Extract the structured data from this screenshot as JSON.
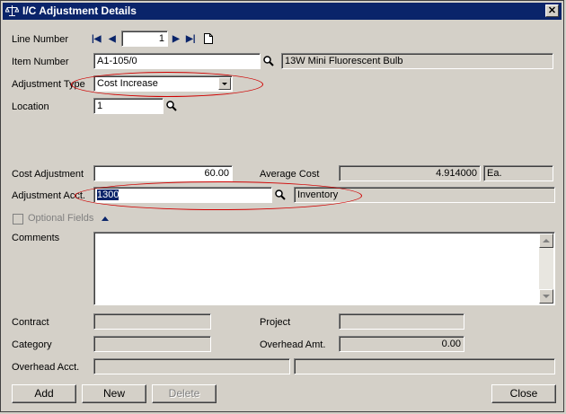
{
  "window": {
    "title": "I/C Adjustment Details"
  },
  "labels": {
    "line_number": "Line Number",
    "item_number": "Item Number",
    "adjustment_type": "Adjustment Type",
    "location": "Location",
    "cost_adjustment": "Cost Adjustment",
    "average_cost": "Average Cost",
    "adjustment_acct": "Adjustment Acct.",
    "optional_fields": "Optional Fields",
    "comments": "Comments",
    "contract": "Contract",
    "project": "Project",
    "category": "Category",
    "overhead_amt": "Overhead Amt.",
    "overhead_acct": "Overhead Acct."
  },
  "values": {
    "line_number": "1",
    "item_number": "A1-105/0",
    "item_description": "13W Mini Fluorescent Bulb",
    "adjustment_type": "Cost Increase",
    "location": "1",
    "cost_adjustment": "60.00",
    "average_cost": "4.914000",
    "unit": "Ea.",
    "adjustment_acct": "1300",
    "adjustment_acct_desc": "Inventory",
    "comments": "",
    "contract": "",
    "project": "",
    "category": "",
    "overhead_amt": "0.00",
    "overhead_acct": "",
    "overhead_acct_desc": ""
  },
  "buttons": {
    "add": "Add",
    "new": "New",
    "delete": "Delete",
    "close": "Close"
  },
  "colors": {
    "titlebar": "#0a246a",
    "highlight_ellipse": "#d00000"
  }
}
